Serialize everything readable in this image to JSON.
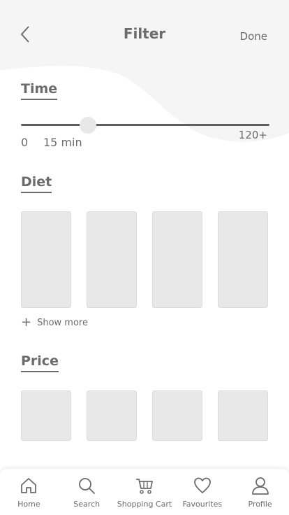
{
  "header": {
    "title": "Filter",
    "done_label": "Done"
  },
  "time": {
    "heading": "Time",
    "min_label": "0",
    "max_label": "120+",
    "value_label": "15 min",
    "value": 15,
    "min": 0,
    "max": 120
  },
  "diet": {
    "heading": "Diet",
    "show_more_label": "Show more",
    "cards": 4
  },
  "price": {
    "heading": "Price",
    "cards": 4
  },
  "nav": {
    "items": [
      {
        "label": "Home",
        "icon": "home-icon"
      },
      {
        "label": "Search",
        "icon": "search-icon"
      },
      {
        "label": "Shopping Cart",
        "icon": "cart-icon"
      },
      {
        "label": "Favourites",
        "icon": "heart-icon"
      },
      {
        "label": "Profile",
        "icon": "user-icon"
      }
    ]
  },
  "colors": {
    "text": "#6b6b6b",
    "background_wave": "#f5f5f5",
    "card": "#e8e8e8",
    "slider_track": "#5f5f5f"
  }
}
